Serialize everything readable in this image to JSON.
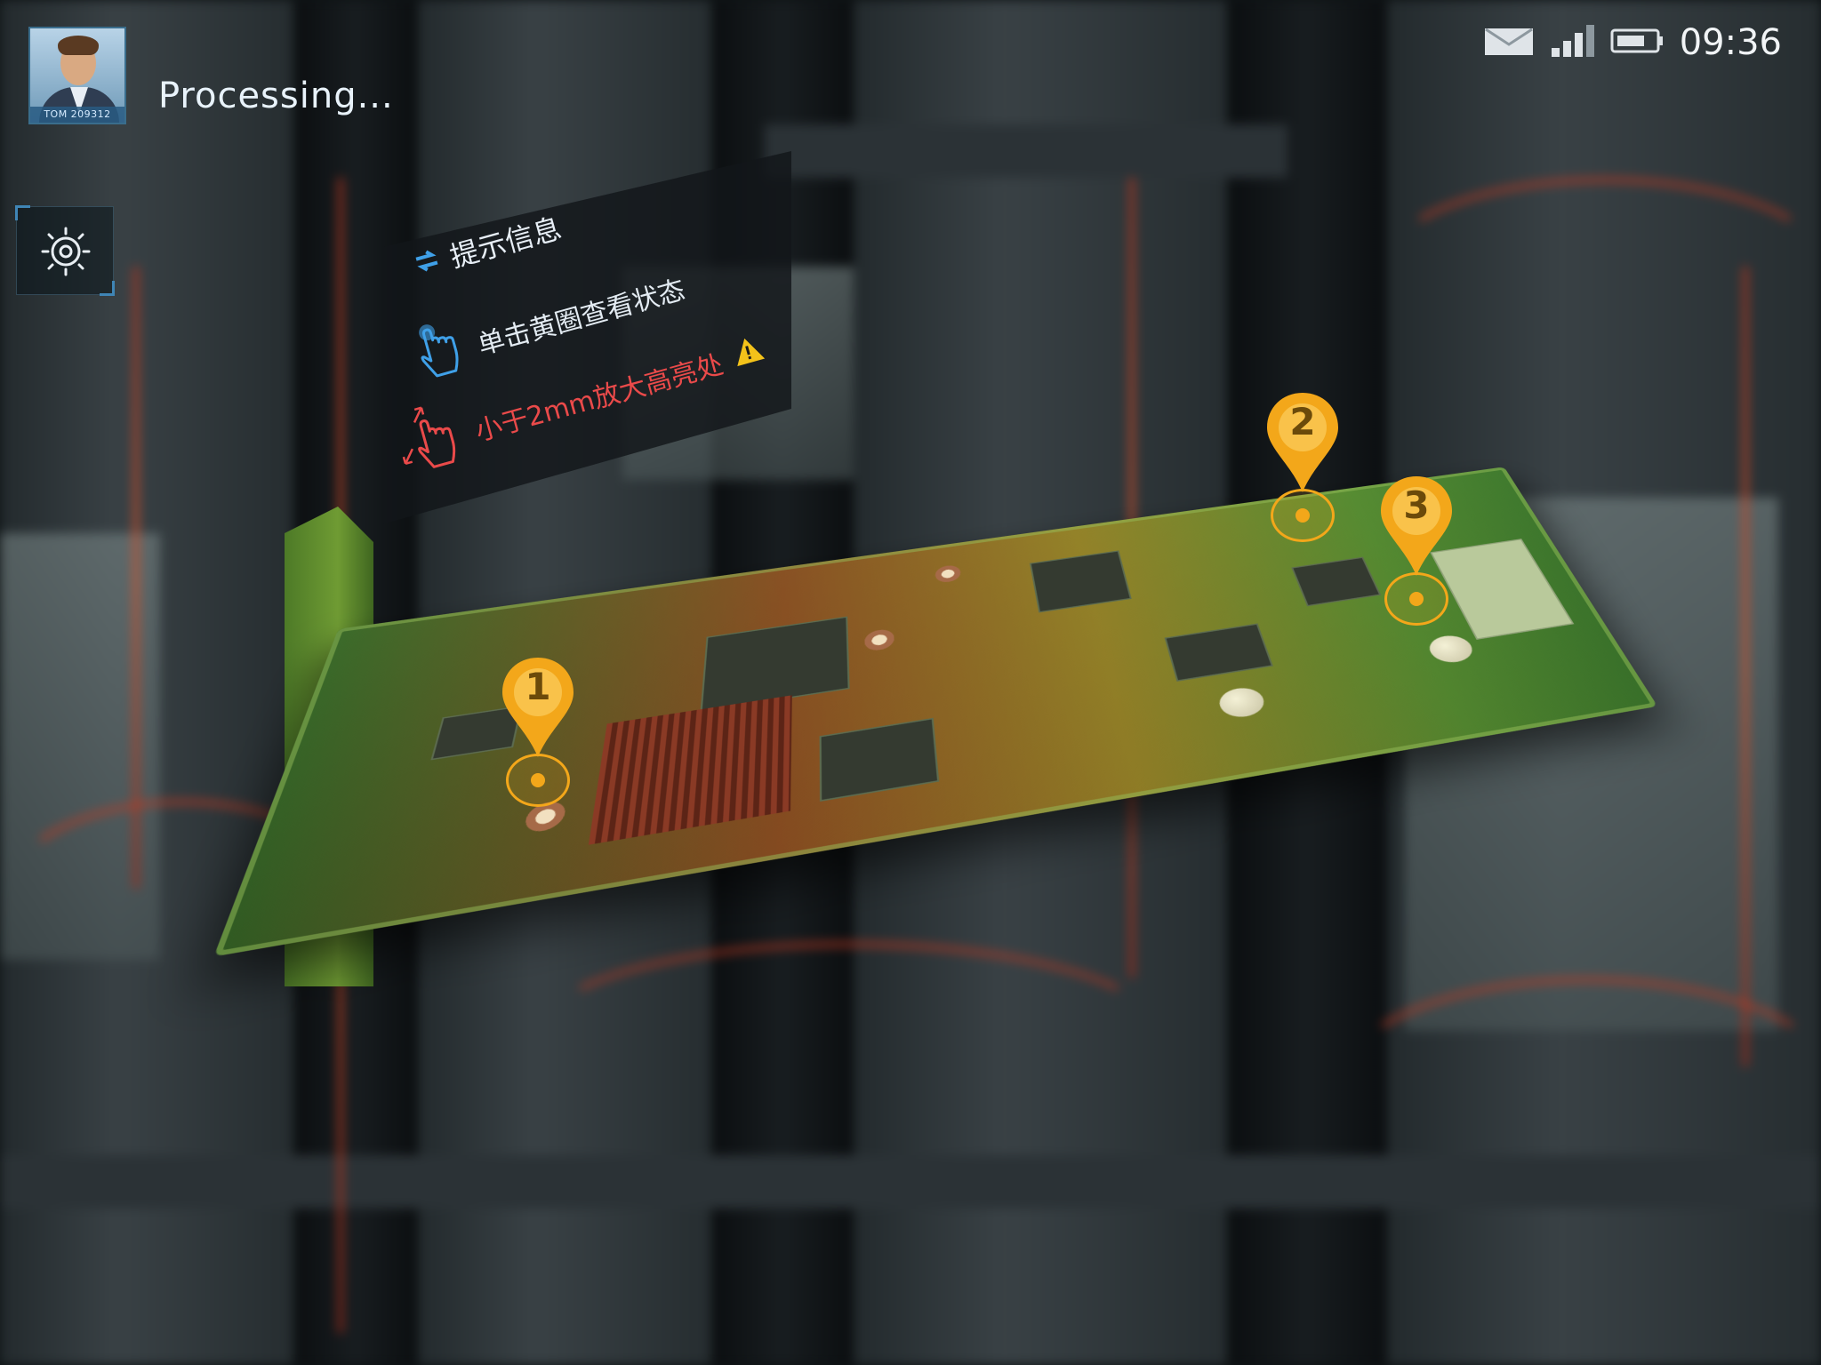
{
  "user": {
    "avatar_tag": "TOM 209312"
  },
  "status": {
    "title": "Processing..."
  },
  "statusbar": {
    "time": "09:36"
  },
  "hint_panel": {
    "title": "提示信息",
    "tap_hint": "单击黄圈查看状态",
    "zoom_hint": "小于2mm放大高亮处"
  },
  "markers": [
    {
      "label": "1"
    },
    {
      "label": "2"
    },
    {
      "label": "3"
    }
  ],
  "colors": {
    "accent": "#3f85b5",
    "marker": "#f3a71a",
    "warning": "#f3c21a",
    "alert_text": "#ea4a4a"
  },
  "icons": {
    "settings": "settings-icon",
    "mail": "mail-icon",
    "signal": "signal-icon",
    "battery": "battery-icon",
    "swap": "swap-icon",
    "tap": "tap-hand-icon",
    "pinch": "pinch-zoom-icon",
    "warning": "warning-icon"
  }
}
